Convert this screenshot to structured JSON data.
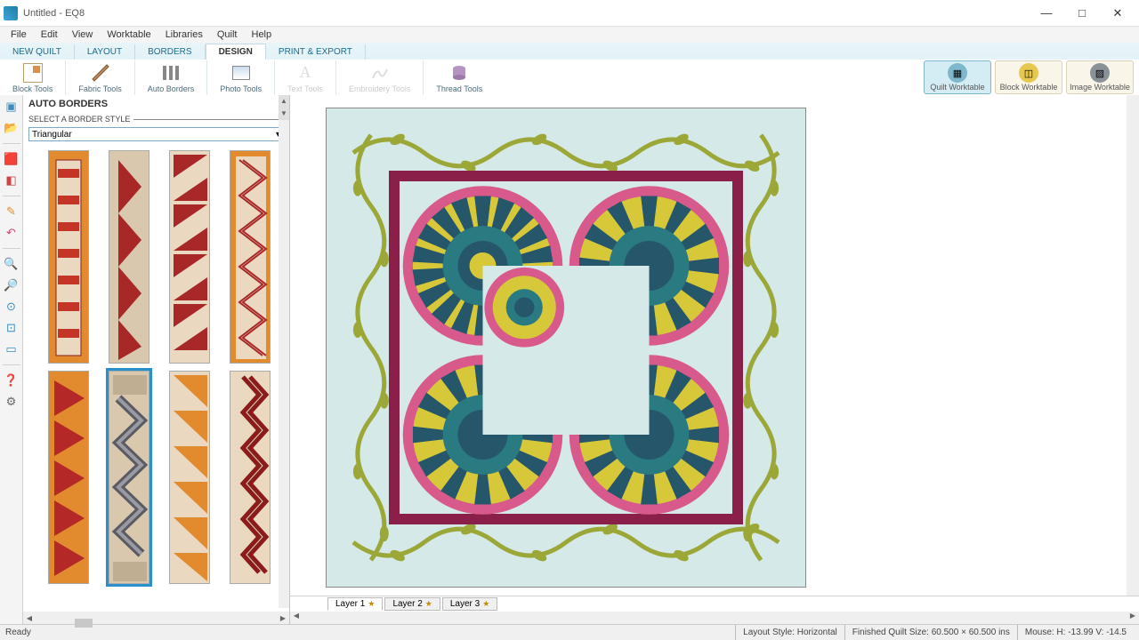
{
  "window": {
    "title": "Untitled - EQ8"
  },
  "menu": [
    "File",
    "Edit",
    "View",
    "Worktable",
    "Libraries",
    "Quilt",
    "Help"
  ],
  "ribbon": {
    "tabs": [
      "NEW QUILT",
      "LAYOUT",
      "BORDERS",
      "DESIGN",
      "PRINT & EXPORT"
    ],
    "active": 3,
    "tools": [
      "Block Tools",
      "Fabric Tools",
      "Auto Borders",
      "Photo Tools",
      "Text Tools",
      "Embroidery Tools",
      "Thread Tools"
    ],
    "modes": [
      "Quilt Worktable",
      "Block Worktable",
      "Image Worktable"
    ]
  },
  "panel": {
    "title": "AUTO BORDERS",
    "subtitle": "SELECT A BORDER STYLE",
    "style_selected": "Triangular"
  },
  "layers": [
    "Layer 1",
    "Layer 2",
    "Layer 3"
  ],
  "status": {
    "ready": "Ready",
    "layout": "Layout Style: Horizontal",
    "size": "Finished Quilt Size: 60.500 × 60.500 ins",
    "mouse": "Mouse: H: -13.99  V: -14.5"
  }
}
